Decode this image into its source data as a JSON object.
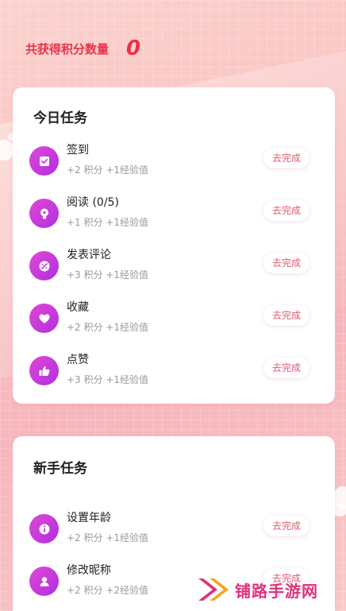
{
  "header": {
    "label": "共获得积分数量",
    "value": "0"
  },
  "daily": {
    "title": "今日任务",
    "tasks": [
      {
        "icon": "calendar-check-icon",
        "name": "签到",
        "reward": "+2 积分 +1经验值",
        "button": "去完成"
      },
      {
        "icon": "lightbulb-icon",
        "name": "阅读 (0/5)",
        "reward": "+1 积分 +1经验值",
        "button": "去完成"
      },
      {
        "icon": "comment-icon",
        "name": "发表评论",
        "reward": "+3 积分 +1经验值",
        "button": "去完成"
      },
      {
        "icon": "heart-icon",
        "name": "收藏",
        "reward": "+2 积分 +1经验值",
        "button": "去完成"
      },
      {
        "icon": "thumbs-up-icon",
        "name": "点赞",
        "reward": "+3 积分 +1经验值",
        "button": "去完成"
      }
    ]
  },
  "newbie": {
    "title": "新手任务",
    "tasks": [
      {
        "icon": "info-icon",
        "name": "设置年龄",
        "reward": "+2 积分 +1经验值",
        "button": "去完成"
      },
      {
        "icon": "user-icon",
        "name": "修改昵称",
        "reward": "+2 积分 +2经验值",
        "button": "去完成"
      }
    ]
  },
  "watermark": {
    "text": "铺路手游网"
  },
  "colors": {
    "accent": "#e8324a",
    "icon_gradient_start": "#e048d6",
    "icon_gradient_end": "#b02fe0",
    "button_text": "#e05a72"
  }
}
